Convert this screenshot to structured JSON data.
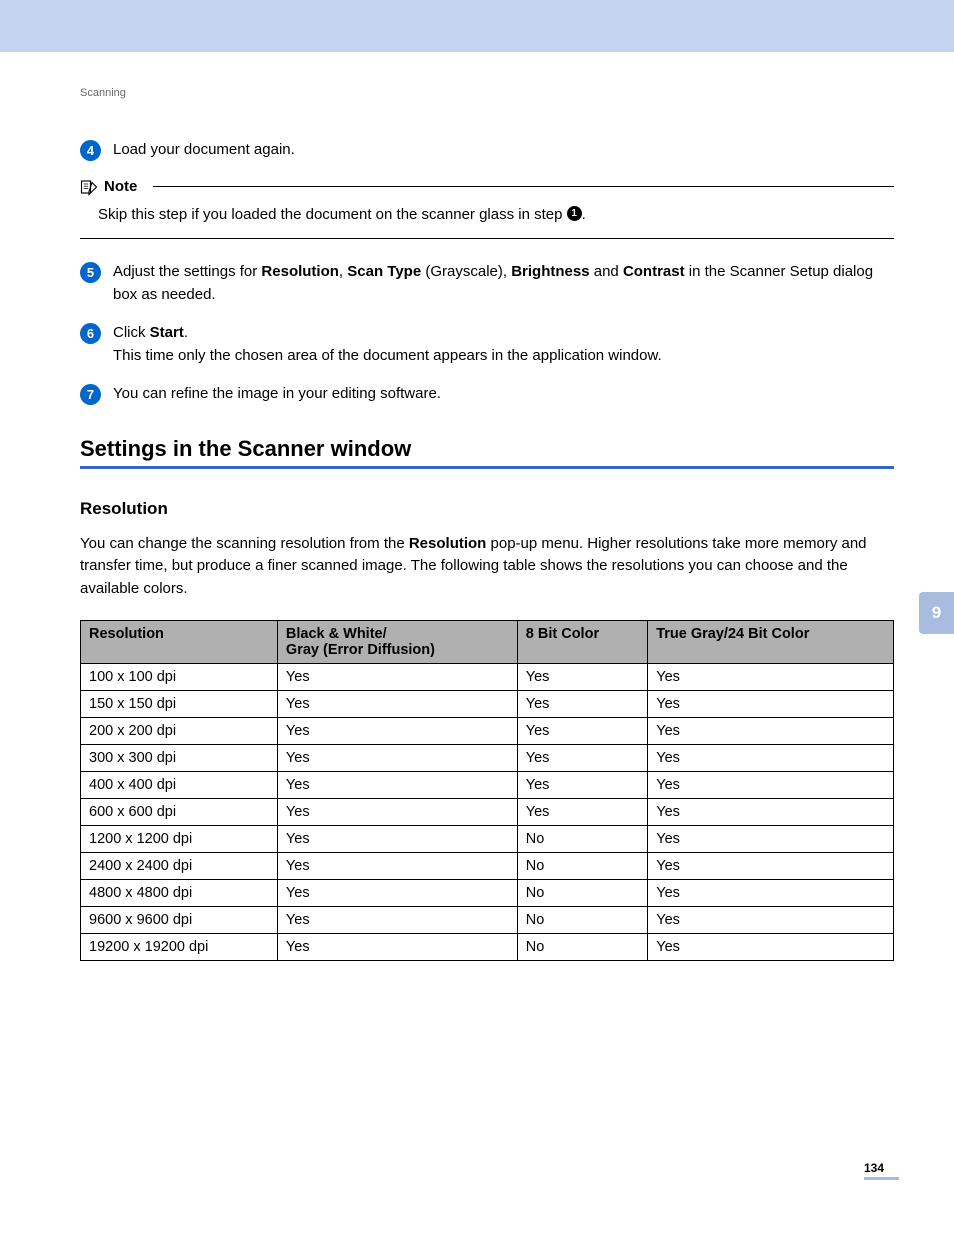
{
  "breadcrumb": "Scanning",
  "steps": [
    {
      "num": "4",
      "parts": [
        {
          "t": "Load your document again.",
          "b": false
        }
      ]
    },
    {
      "num": "5",
      "parts": [
        {
          "t": "Adjust the settings for ",
          "b": false
        },
        {
          "t": "Resolution",
          "b": true
        },
        {
          "t": ", ",
          "b": false
        },
        {
          "t": "Scan Type",
          "b": true
        },
        {
          "t": " (Grayscale), ",
          "b": false
        },
        {
          "t": "Brightness",
          "b": true
        },
        {
          "t": " and ",
          "b": false
        },
        {
          "t": "Contrast",
          "b": true
        },
        {
          "t": " in the Scanner Setup dialog box as needed.",
          "b": false
        }
      ]
    },
    {
      "num": "6",
      "parts": [
        {
          "t": "Click ",
          "b": false
        },
        {
          "t": "Start",
          "b": true
        },
        {
          "t": ".",
          "b": false
        },
        {
          "br": true
        },
        {
          "t": "This time only the chosen area of the document appears in the application window.",
          "b": false
        }
      ]
    },
    {
      "num": "7",
      "parts": [
        {
          "t": "You can refine the image in your editing software.",
          "b": false
        }
      ]
    }
  ],
  "note": {
    "label": "Note",
    "body_prefix": "Skip this step if you loaded the document on the scanner glass in step ",
    "ref": "1",
    "body_suffix": "."
  },
  "section_title": "Settings in the Scanner window",
  "sub_heading": "Resolution",
  "resolution_para_parts": [
    {
      "t": "You can change the scanning resolution from the ",
      "b": false
    },
    {
      "t": "Resolution",
      "b": true
    },
    {
      "t": " pop-up menu. Higher resolutions take more memory and transfer time, but produce a finer scanned image. The following table shows the resolutions you can choose and the available colors.",
      "b": false
    }
  ],
  "table": {
    "headers": [
      "Resolution",
      "Black & White/\nGray (Error Diffusion)",
      "8 Bit Color",
      "True Gray/24 Bit Color"
    ],
    "rows": [
      [
        "100 x 100 dpi",
        "Yes",
        "Yes",
        "Yes"
      ],
      [
        "150 x 150 dpi",
        "Yes",
        "Yes",
        "Yes"
      ],
      [
        "200 x 200 dpi",
        "Yes",
        "Yes",
        "Yes"
      ],
      [
        "300 x 300 dpi",
        "Yes",
        "Yes",
        "Yes"
      ],
      [
        "400 x 400 dpi",
        "Yes",
        "Yes",
        "Yes"
      ],
      [
        "600 x 600 dpi",
        "Yes",
        "Yes",
        "Yes"
      ],
      [
        "1200 x 1200 dpi",
        "Yes",
        "No",
        "Yes"
      ],
      [
        "2400 x 2400 dpi",
        "Yes",
        "No",
        "Yes"
      ],
      [
        "4800 x 4800 dpi",
        "Yes",
        "No",
        "Yes"
      ],
      [
        "9600 x 9600 dpi",
        "Yes",
        "No",
        "Yes"
      ],
      [
        "19200 x 19200 dpi",
        "Yes",
        "No",
        "Yes"
      ]
    ]
  },
  "side_tab": "9",
  "page_number": "134",
  "chart_data": {
    "type": "table",
    "title": "Resolution capability matrix",
    "columns": [
      "Resolution",
      "Black & White / Gray (Error Diffusion)",
      "8 Bit Color",
      "True Gray / 24 Bit Color"
    ],
    "rows": [
      [
        "100 x 100 dpi",
        "Yes",
        "Yes",
        "Yes"
      ],
      [
        "150 x 150 dpi",
        "Yes",
        "Yes",
        "Yes"
      ],
      [
        "200 x 200 dpi",
        "Yes",
        "Yes",
        "Yes"
      ],
      [
        "300 x 300 dpi",
        "Yes",
        "Yes",
        "Yes"
      ],
      [
        "400 x 400 dpi",
        "Yes",
        "Yes",
        "Yes"
      ],
      [
        "600 x 600 dpi",
        "Yes",
        "Yes",
        "Yes"
      ],
      [
        "1200 x 1200 dpi",
        "Yes",
        "No",
        "Yes"
      ],
      [
        "2400 x 2400 dpi",
        "Yes",
        "No",
        "Yes"
      ],
      [
        "4800 x 4800 dpi",
        "Yes",
        "No",
        "Yes"
      ],
      [
        "9600 x 9600 dpi",
        "Yes",
        "No",
        "Yes"
      ],
      [
        "19200 x 19200 dpi",
        "Yes",
        "No",
        "Yes"
      ]
    ]
  }
}
